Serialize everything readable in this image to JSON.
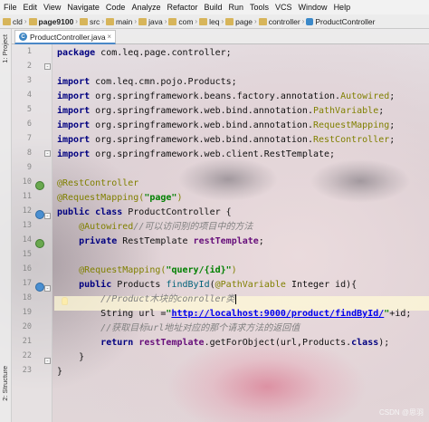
{
  "menu": [
    "File",
    "Edit",
    "View",
    "Navigate",
    "Code",
    "Analyze",
    "Refactor",
    "Build",
    "Run",
    "Tools",
    "VCS",
    "Window",
    "Help"
  ],
  "breadcrumbs": [
    "cld",
    "page9100",
    "src",
    "main",
    "java",
    "com",
    "leq",
    "page",
    "controller",
    "ProductController"
  ],
  "tab": {
    "label": "ProductController.java",
    "close": "×"
  },
  "side_tools": {
    "project": "1: Project",
    "structure": "2: Structure"
  },
  "line_numbers": [
    "1",
    "2",
    "3",
    "4",
    "5",
    "6",
    "7",
    "8",
    "9",
    "10",
    "11",
    "12",
    "13",
    "14",
    "15",
    "16",
    "17",
    "18",
    "19",
    "20",
    "21",
    "22",
    "23"
  ],
  "code": {
    "package_kw": "package",
    "package_name": " com.leq.page.controller;",
    "import_kw": "import",
    "imports": [
      {
        "path": " com.leq.cmn.pojo.Products;"
      },
      {
        "path": " org.springframework.beans.factory.annotation.",
        "cls": "Autowired",
        "end": ";"
      },
      {
        "path": " org.springframework.web.bind.annotation.",
        "cls": "PathVariable",
        "end": ";"
      },
      {
        "path": " org.springframework.web.bind.annotation.",
        "cls": "RequestMapping",
        "end": ";"
      },
      {
        "path": " org.springframework.web.bind.annotation.",
        "cls": "RestController",
        "end": ";"
      },
      {
        "path": " org.springframework.web.client.RestTemplate;"
      }
    ],
    "ann_rest": "@RestController",
    "ann_mapping": "@RequestMapping(",
    "mapping_value": "\"page\"",
    "close_paren": ")",
    "public_class": "public class",
    "class_decl": " ProductController {",
    "ann_autowired": "@Autowired",
    "comment_autowired": "//可以访问别的项目中的方法",
    "private_kw": "private",
    "rest_type": " RestTemplate ",
    "rest_field": "restTemplate",
    "semicolon": ";",
    "ann_mapping2": "@RequestMapping(",
    "mapping2_value": "\"query/{id}\"",
    "public_kw": "public",
    "method_ret": " Products ",
    "method_name": "findById",
    "method_args_open": "(",
    "path_var": "@PathVariable",
    "method_args_rest": " Integer id){",
    "comment_product": "//Product木块的conroller类",
    "string_kw_decl": "String url =",
    "url_quote_open": "\"",
    "url": "http://localhost:9000/product/findById/",
    "url_quote_close": "\"",
    "url_concat": "+id;",
    "comment_get": "//获取目标url地址对应的那个请求方法的返回值",
    "return_kw": "return",
    "return_field": "restTemplate",
    "return_call": ".getForObject(url,Products.",
    "class_kw": "class",
    "return_end": ");",
    "close_method": "}",
    "close_class": "}"
  },
  "watermark": "CSDN @思羽"
}
